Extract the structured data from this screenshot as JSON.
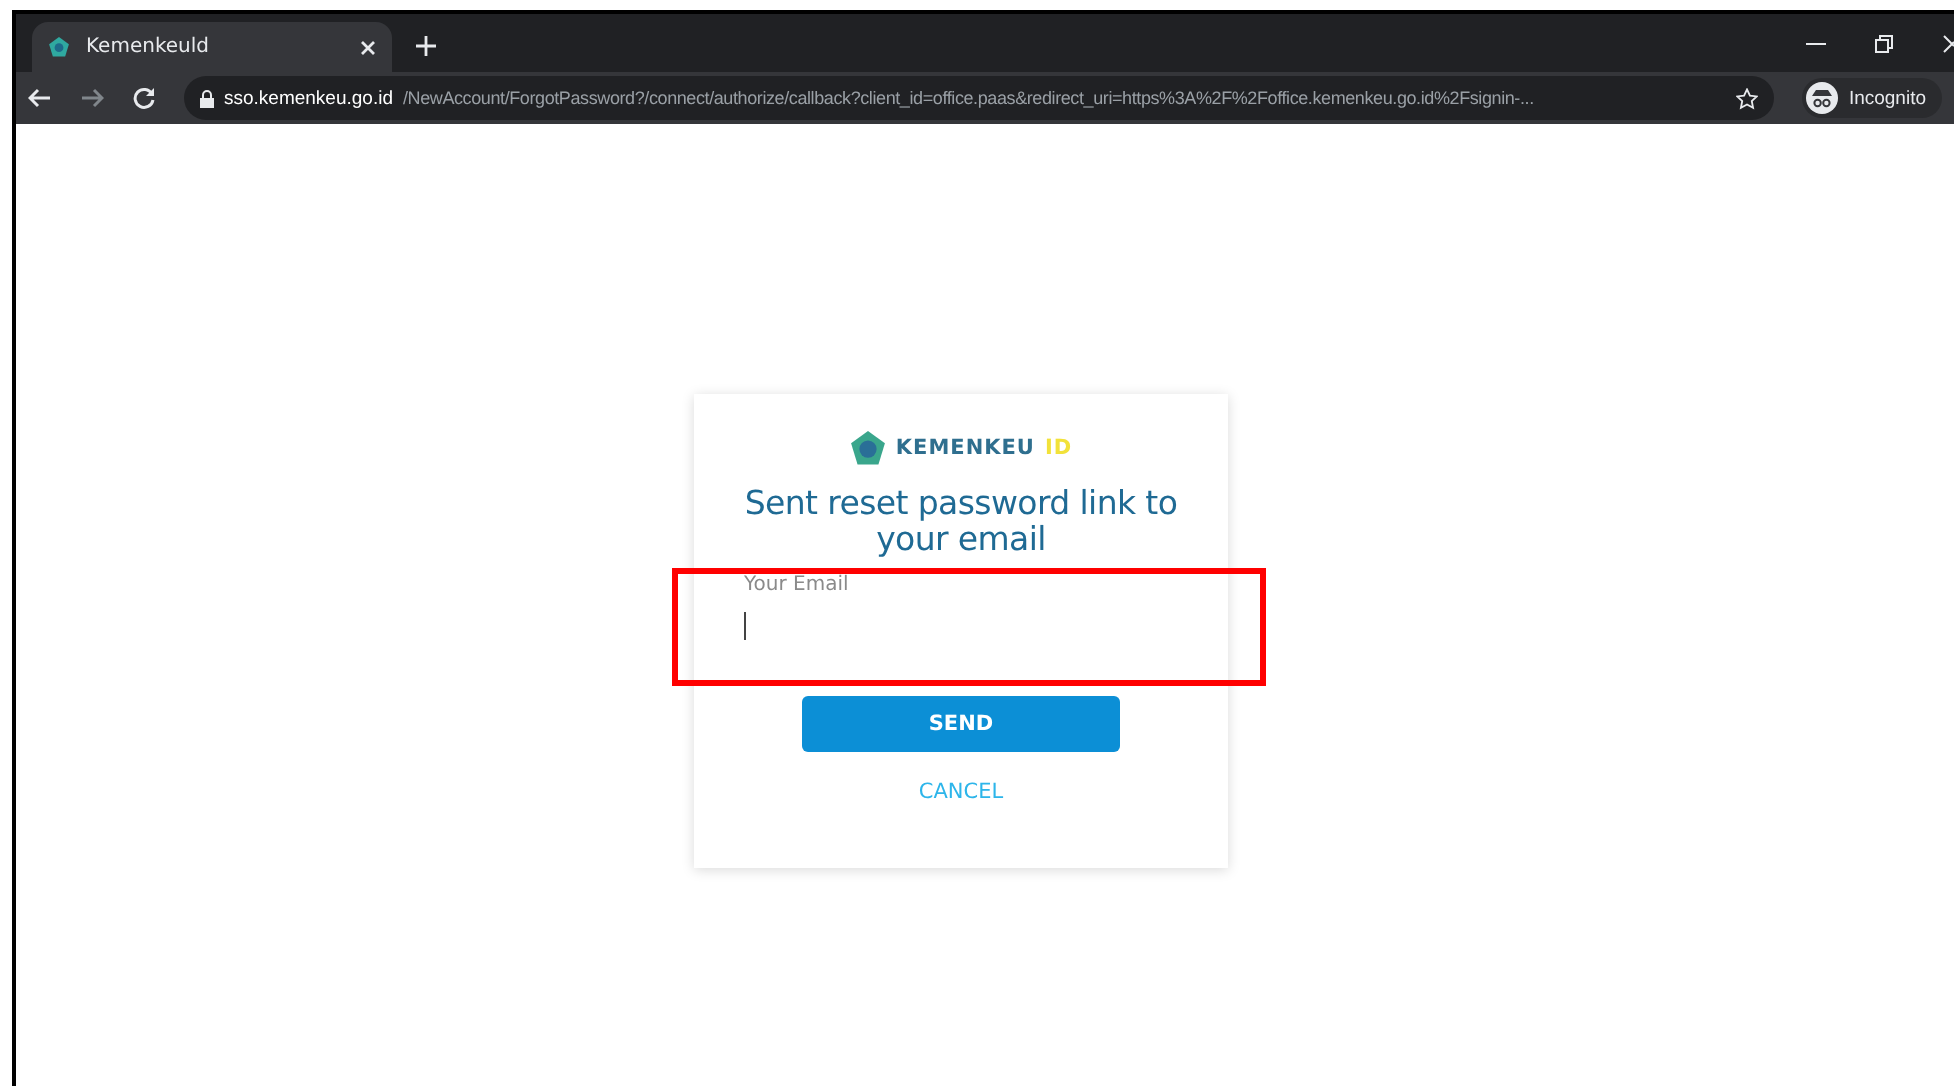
{
  "browser": {
    "tabs": [
      {
        "title": "Kemenkeuld",
        "selected": true
      }
    ],
    "url": {
      "domain": "sso.kemenkeu.go.id",
      "path": "/NewAccount/ForgotPassword?/connect/authorize/callback?client_id=office.paas&redirect_uri=https%3A%2F%2Foffice.kemenkeu.go.id%2Fsignin-..."
    },
    "profile": "Incognito"
  },
  "card": {
    "logo": {
      "main": "KEMENKEU",
      "suffix": "ID"
    },
    "heading": "Sent reset password link to your email",
    "email_field": {
      "label": "Your Email",
      "focused": true
    },
    "send_button": "SEND",
    "cancel_link": "CANCEL"
  }
}
